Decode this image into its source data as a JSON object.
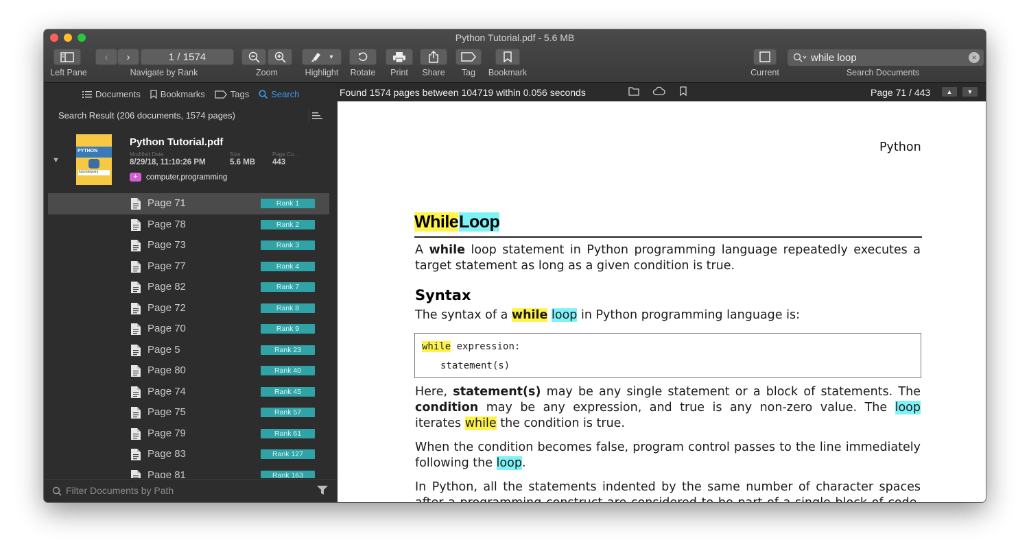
{
  "window": {
    "title": "Python Tutorial.pdf - 5.6 MB"
  },
  "toolbar": {
    "left_pane": "Left Pane",
    "navigate": "Navigate by Rank",
    "page_field": "1 / 1574",
    "zoom": "Zoom",
    "highlight": "Highlight",
    "rotate": "Rotate",
    "print": "Print",
    "share": "Share",
    "tag": "Tag",
    "bookmark": "Bookmark",
    "current": "Current",
    "search_documents": "Search Documents",
    "search_value": "while loop"
  },
  "sidebar": {
    "tabs": [
      {
        "label": "Documents",
        "icon": "list-icon"
      },
      {
        "label": "Bookmarks",
        "icon": "bookmark-icon"
      },
      {
        "label": "Tags",
        "icon": "tag-icon"
      },
      {
        "label": "Search",
        "icon": "search-icon",
        "active": true
      }
    ],
    "result_summary": "Search Result (206 documents, 1574 pages)",
    "document": {
      "title": "Python Tutorial.pdf",
      "modified_label": "Modified Date",
      "modified": "8/29/18, 11:10:26 PM",
      "size_label": "Size",
      "size": "5.6 MB",
      "pages_label": "Page Co...",
      "pages": "443",
      "tags": "computer,programming"
    },
    "results": [
      {
        "page": "Page 71",
        "rank": "Rank 1",
        "selected": true
      },
      {
        "page": "Page 78",
        "rank": "Rank 2"
      },
      {
        "page": "Page 73",
        "rank": "Rank 3"
      },
      {
        "page": "Page 77",
        "rank": "Rank 4"
      },
      {
        "page": "Page 82",
        "rank": "Rank 7"
      },
      {
        "page": "Page 72",
        "rank": "Rank 8"
      },
      {
        "page": "Page 70",
        "rank": "Rank 9"
      },
      {
        "page": "Page 5",
        "rank": "Rank 23"
      },
      {
        "page": "Page 80",
        "rank": "Rank 40"
      },
      {
        "page": "Page 74",
        "rank": "Rank 45"
      },
      {
        "page": "Page 75",
        "rank": "Rank 57"
      },
      {
        "page": "Page 79",
        "rank": "Rank 61"
      },
      {
        "page": "Page 83",
        "rank": "Rank 127"
      },
      {
        "page": "Page 81",
        "rank": "Rank 163"
      }
    ],
    "filter_placeholder": "Filter Documents by Path"
  },
  "mainbar": {
    "found": "Found 1574 pages between 104719 within 0.056 seconds",
    "page_indicator": "Page 71 / 443"
  },
  "page": {
    "header": "Python",
    "h1_word1": "While",
    "h1_word2": "Loop",
    "p1_a": "A",
    "p1_bold": "while",
    "p1_rest": "loop statement in Python programming language repeatedly executes a target statement as long as a given condition is true.",
    "syntax_heading": "Syntax",
    "syntax_pre": "The syntax of a",
    "syntax_while": "while",
    "syntax_loop": "loop",
    "syntax_post": "in Python programming language is:",
    "code_kw": "while",
    "code_line1_rest": " expression:",
    "code_line2": "statement(s)",
    "p3_a": "Here,",
    "p3_bold1": "statement(s)",
    "p3_b": "may be any single statement or a block of statements. The",
    "p3_bold2": "condition",
    "p3_c": "may be any expression, and true is any non-zero value. The",
    "p3_loop": "loop",
    "p3_d": "iterates",
    "p3_while": "while",
    "p3_e": "the condition is true.",
    "p4_a": "When the condition becomes false, program control passes to the line immediately following the",
    "p4_loop": "loop",
    "p4_b": ".",
    "p5": "In Python, all the statements indented by the same number of character spaces after a programming construct are considered to be part of a single block of code. Python"
  },
  "colors": {
    "highlight_yellow": "#fff34a",
    "highlight_cyan": "#7ef2f7",
    "rank_badge": "#2fa3a6",
    "accent_blue": "#3c9bf5",
    "tag_purple": "#d35fd2"
  }
}
